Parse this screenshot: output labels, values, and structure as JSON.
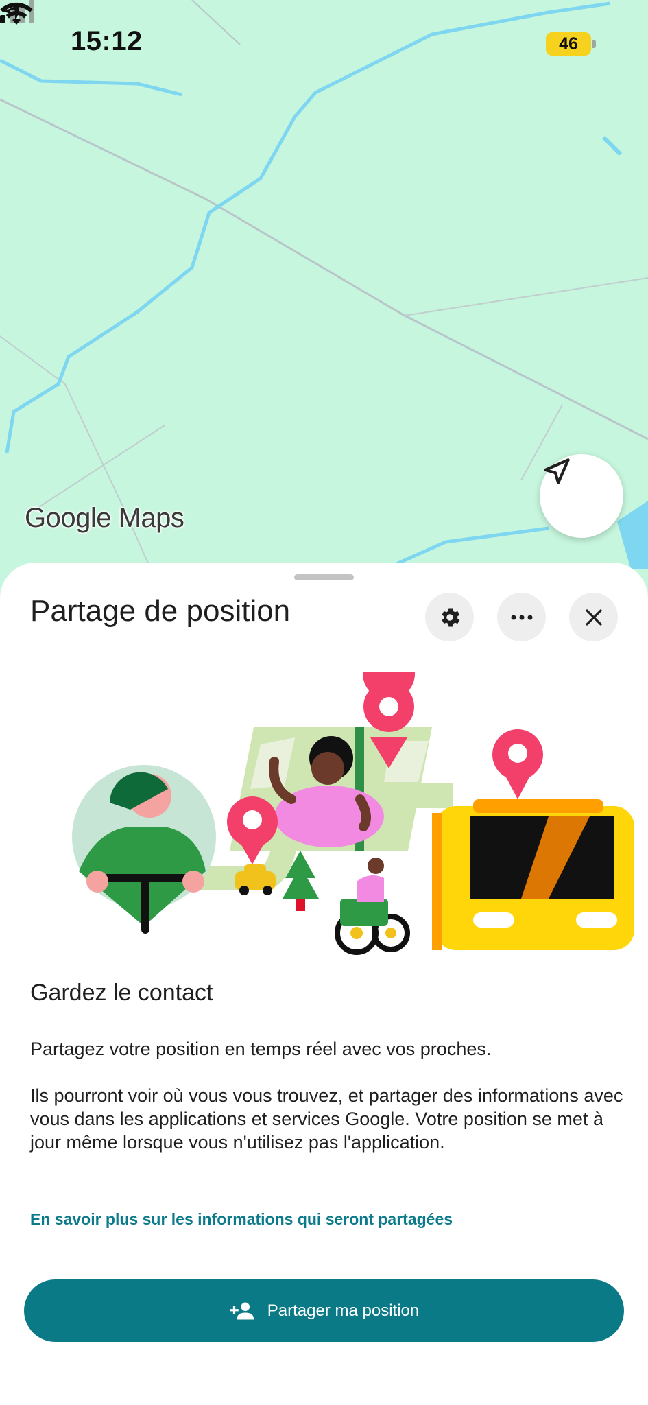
{
  "status_bar": {
    "time": "15:12",
    "battery": "46",
    "icons": [
      "location-arrow-icon",
      "signal-bars-icon",
      "wifi-icon",
      "battery-icon"
    ]
  },
  "map": {
    "logo_text": "Google Maps",
    "recenter_icon": "navigation-arrow-icon",
    "colors": {
      "land": "#c6f6dd",
      "water": "#7fd6f0",
      "road": "#b8c4c8"
    }
  },
  "sheet": {
    "title": "Partage de position",
    "header_icons": [
      "gear-icon",
      "more-horizontal-icon",
      "close-icon"
    ],
    "heading": "Gardez le contact",
    "paragraph1": "Partagez votre position en temps réel avec vos proches.",
    "paragraph2": "Ils pourront voir où vous vous trouvez, et partager des informations avec vous dans les applications et services Google. Votre position se met à jour même lorsque vous n'utilisez pas l'application.",
    "learn_more": "En savoir plus sur les informations qui seront partagées",
    "primary_button": {
      "label": "Partager ma position",
      "icon": "add-person-icon"
    },
    "colors": {
      "accent": "#0a7a87",
      "pin": "#f2406a"
    }
  }
}
